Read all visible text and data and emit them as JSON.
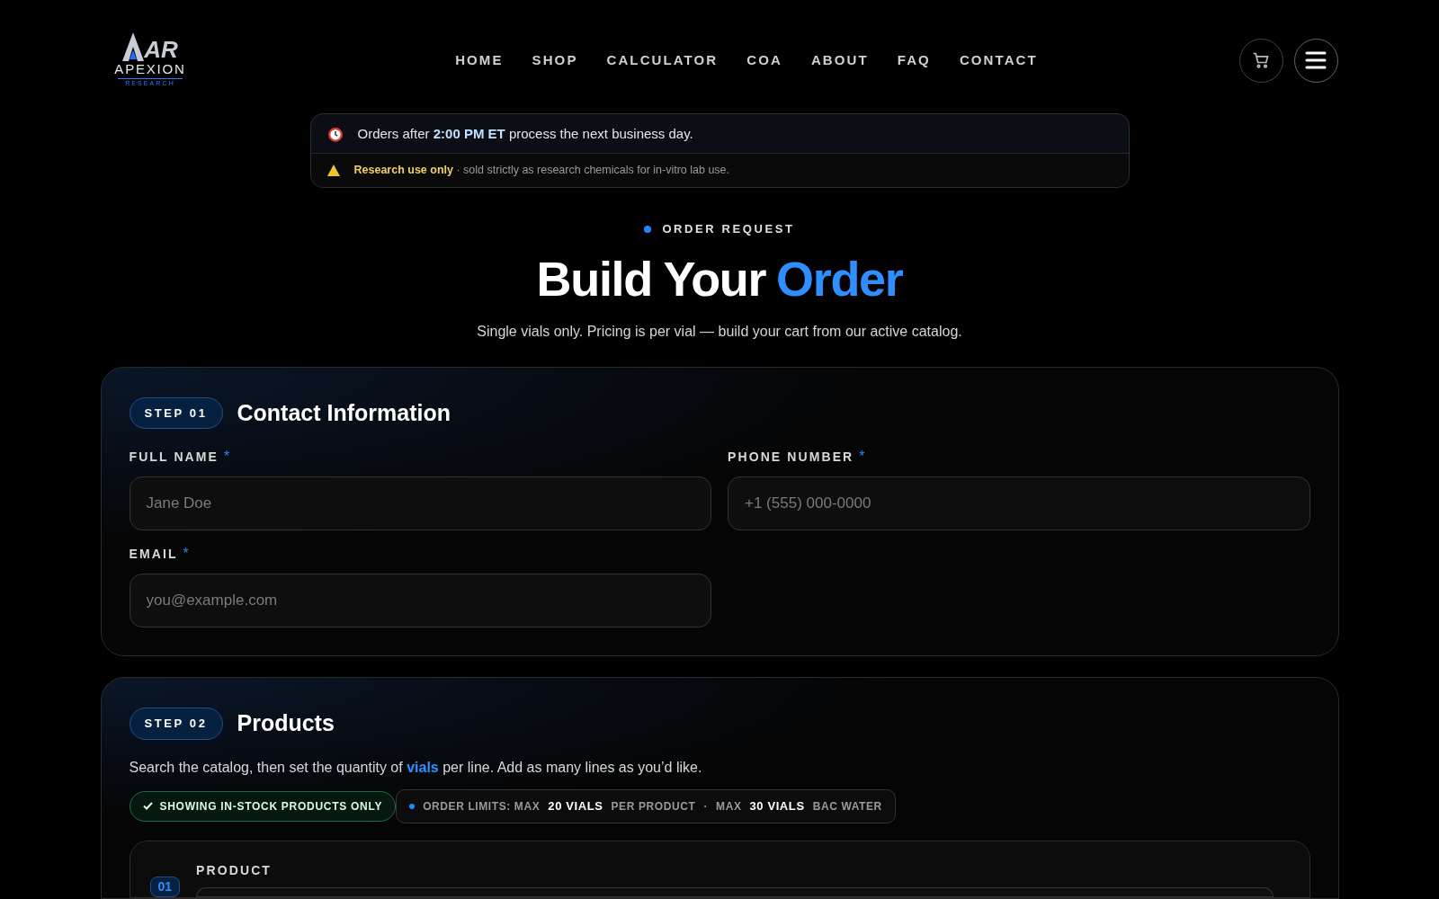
{
  "logo": {
    "mark": "AR",
    "name": "APEXION",
    "tagline": "RESEARCH"
  },
  "nav": [
    {
      "label": "HOME"
    },
    {
      "label": "SHOP"
    },
    {
      "label": "CALCULATOR"
    },
    {
      "label": "COA"
    },
    {
      "label": "ABOUT"
    },
    {
      "label": "FAQ"
    },
    {
      "label": "CONTACT"
    }
  ],
  "notice": {
    "cutoff": "Orders after **2:00 PM ET** process the next business day.",
    "warning_label": "Research use only",
    "warning_text": "· sold strictly as research chemicals for in-vitro lab use."
  },
  "hero": {
    "eyebrow": "ORDER REQUEST",
    "title": "Build Your",
    "title_accent": "Order",
    "subtitle": "Single vials only. Pricing is per vial — build your cart from our active catalog."
  },
  "contact": {
    "step": "STEP 01",
    "title": "Contact Information",
    "fields": [
      {
        "label": "FULL NAME",
        "required_mark": "*",
        "placeholder": "Jane Doe"
      },
      {
        "label": "PHONE NUMBER",
        "required_mark": "*",
        "placeholder": "+1 (555) 000-0000"
      },
      {
        "label": "EMAIL",
        "required_mark": "*",
        "placeholder": "you@example.com"
      }
    ]
  },
  "products": {
    "step": "STEP 02",
    "title": "Products",
    "intro_before": "Search the catalog, then set the quantity of",
    "intro_link": "vials",
    "intro_after": "per line. Add as many lines as you’d like.",
    "stock_filter": {
      "label": "SHOWING IN-STOCK PRODUCTS ONLY",
      "checked": true
    },
    "limits": [
      "ORDER LIMITS: MAX",
      "20 VIALS",
      "PER PRODUCT",
      "·",
      "MAX",
      "30 VIALS",
      "BAC WATER"
    ],
    "lines": [
      {
        "number": "01",
        "label": "PRODUCT"
      }
    ]
  }
}
